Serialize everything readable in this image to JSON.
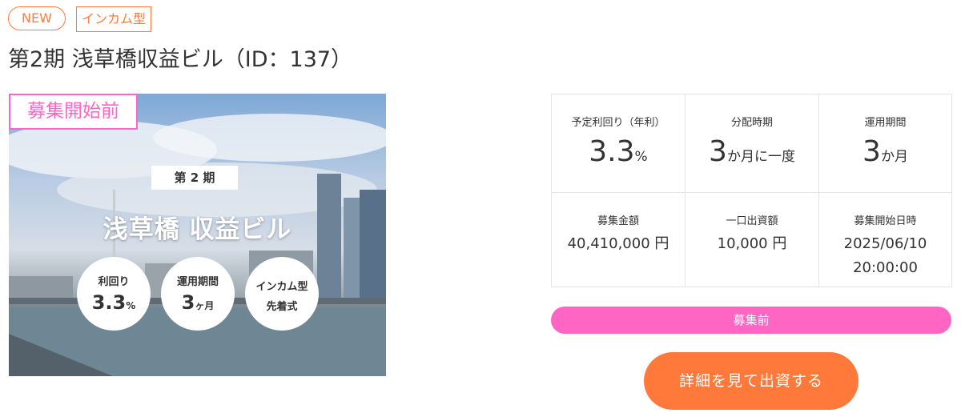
{
  "tags": {
    "new": "NEW",
    "type": "インカム型"
  },
  "title": "第2期 浅草橋収益ビル（ID：137）",
  "hero": {
    "status_badge": "募集開始前",
    "round_label": "第 2 期",
    "title": "浅草橋 収益ビル",
    "circles": [
      {
        "label": "利回り",
        "value": "3.3",
        "unit": "%"
      },
      {
        "label": "運用期間",
        "value": "3",
        "unit": "ヶ月"
      },
      {
        "line1": "インカム型",
        "line2": "先着式"
      }
    ]
  },
  "info": {
    "yield": {
      "label": "予定利回り（年利）",
      "value": "3.3",
      "unit": "%"
    },
    "distribution": {
      "label": "分配時期",
      "value": "3",
      "unit": "か月に一度"
    },
    "term": {
      "label": "運用期間",
      "value": "3",
      "unit": "か月"
    },
    "amount": {
      "label": "募集金額",
      "value": "40,410,000 円"
    },
    "unit_price": {
      "label": "一口出資額",
      "value": "10,000 円"
    },
    "start": {
      "label": "募集開始日時",
      "date": "2025/06/10",
      "time": "20:00:00"
    }
  },
  "status_bar": "募集前",
  "cta": "詳細を見て出資する",
  "colors": {
    "accent": "#ff7c3b",
    "pink": "#ff66c4",
    "cta": "#ff7a3a"
  }
}
